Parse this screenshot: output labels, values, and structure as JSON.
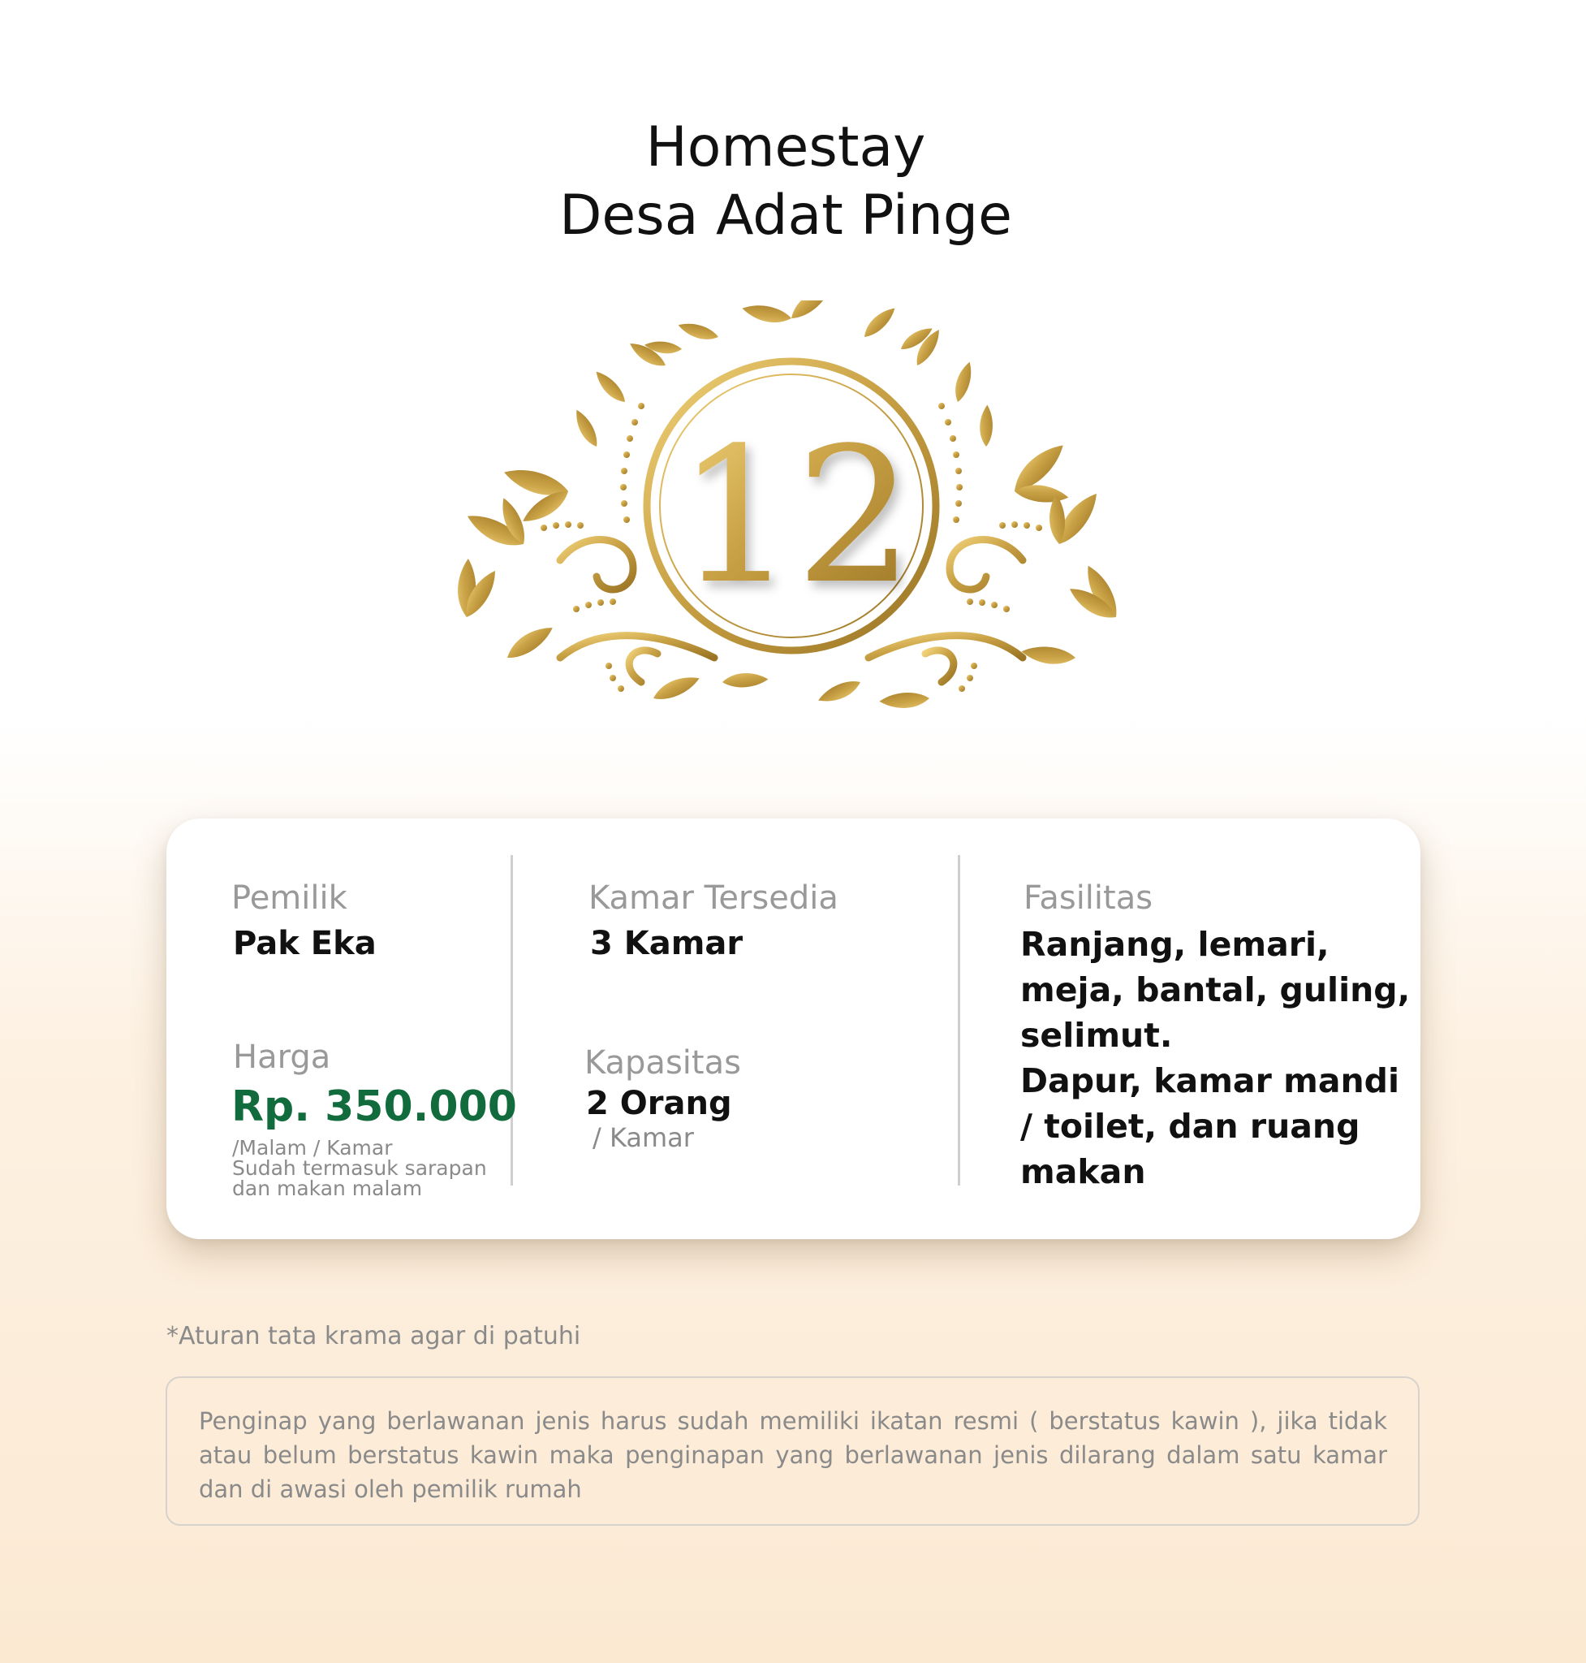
{
  "header": {
    "title_line1": "Homestay",
    "title_line2": "Desa Adat Pinge"
  },
  "emblem": {
    "number": "12",
    "icon": "gold-laurel-crest-icon",
    "color": "#c9a145"
  },
  "info_card": {
    "owner": {
      "label": "Pemilik",
      "value": "Pak Eka"
    },
    "price": {
      "label": "Harga",
      "value": "Rp. 350.000",
      "unit": "/Malam / Kamar",
      "note_line1": "Sudah termasuk sarapan",
      "note_line2": "dan makan malam",
      "color": "#116b3c"
    },
    "rooms": {
      "label": "Kamar Tersedia",
      "value": "3 Kamar"
    },
    "capacity": {
      "label": "Kapasitas",
      "value": "2 Orang",
      "unit": "/ Kamar"
    },
    "facilities": {
      "label": "Fasilitas",
      "lines": [
        "Ranjang, lemari,",
        "meja, bantal, guling,",
        "selimut.",
        "Dapur, kamar mandi",
        "/ toilet, dan ruang",
        "makan"
      ]
    }
  },
  "rules": {
    "note": "*Aturan tata krama agar di patuhi",
    "text": "Penginap yang berlawanan jenis harus sudah memiliki ikatan resmi ( berstatus kawin ), jika tidak atau belum berstatus kawin maka penginapan yang berlawanan jenis dilarang dalam satu kamar dan di awasi oleh pemilik rumah"
  }
}
